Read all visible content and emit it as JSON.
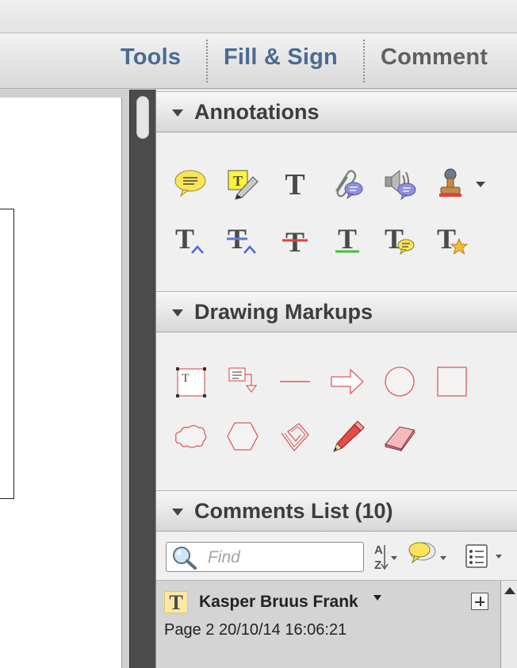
{
  "toolbar": {
    "tools_label": "Tools",
    "fill_sign_label": "Fill & Sign",
    "comment_label": "Comment"
  },
  "annotations": {
    "title": "Annotations",
    "tools_row1": [
      "sticky-note-icon",
      "highlight-text-icon",
      "add-text-icon",
      "attach-file-icon",
      "record-audio-icon",
      "stamp-icon"
    ],
    "tools_row2": [
      "insert-text-icon",
      "replace-text-icon",
      "strikethrough-icon",
      "underline-icon",
      "add-note-to-text-icon",
      "text-correction-icon"
    ],
    "text_glyph": "T"
  },
  "drawing": {
    "title": "Drawing Markups",
    "tools_row1": [
      "text-box-icon",
      "callout-icon",
      "line-icon",
      "arrow-icon",
      "oval-icon",
      "rectangle-icon"
    ],
    "tools_row2": [
      "cloud-icon",
      "polygon-icon",
      "connected-lines-icon",
      "pencil-icon",
      "eraser-icon"
    ],
    "text_glyph": "T"
  },
  "comments": {
    "title": "Comments List (10)",
    "find_placeholder": "Find",
    "items": [
      {
        "type_glyph": "T",
        "author": "Kasper Bruus Frank",
        "meta": "Page 2  20/10/14 16:06:21"
      }
    ]
  },
  "colors": {
    "accent_blue": "#4a6b93",
    "drawing_red": "#e05a5a",
    "section_text": "#3b3d40"
  }
}
